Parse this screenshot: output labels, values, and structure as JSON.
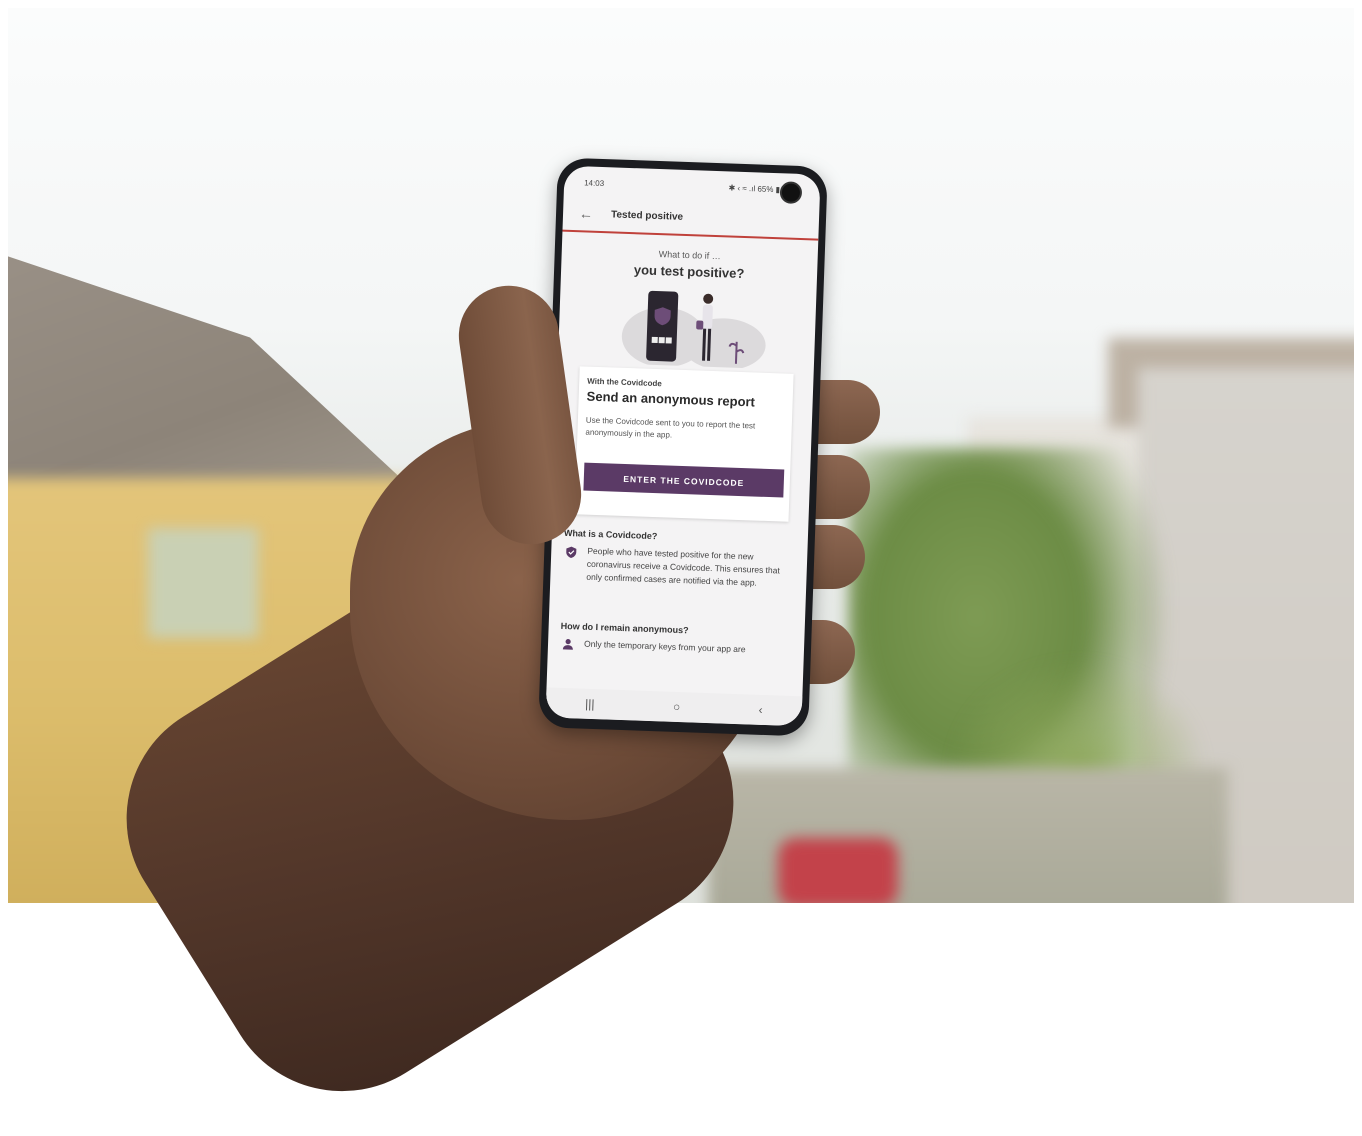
{
  "status_bar": {
    "time": "14:03",
    "indicators": "✱ ‹ ≈ .ıl 65% ▮"
  },
  "app_bar": {
    "back_icon": "arrow-left-icon",
    "title": "Tested positive"
  },
  "hero": {
    "subtitle": "What to do if …",
    "title": "you test positive?"
  },
  "card": {
    "overline": "With the Covidcode",
    "heading": "Send an anonymous report",
    "body": "Use the Covidcode sent to you to report the test anonymously in the app.",
    "button": "ENTER THE COVIDCODE"
  },
  "faq": [
    {
      "question": "What is a Covidcode?",
      "icon": "shield-check-icon",
      "answer": "People who have tested positive for the new coronavirus receive a Covidcode. This ensures that only confirmed cases are notified via the app."
    },
    {
      "question": "How do I remain anonymous?",
      "icon": "person-icon",
      "answer": "Only the temporary keys from your app are"
    }
  ],
  "nav_bar": {
    "recents": "|||",
    "home": "○",
    "back": "‹"
  },
  "colors": {
    "accent": "#5b3a66",
    "divider": "#c0413b",
    "screen_bg": "#f4f3f4"
  }
}
